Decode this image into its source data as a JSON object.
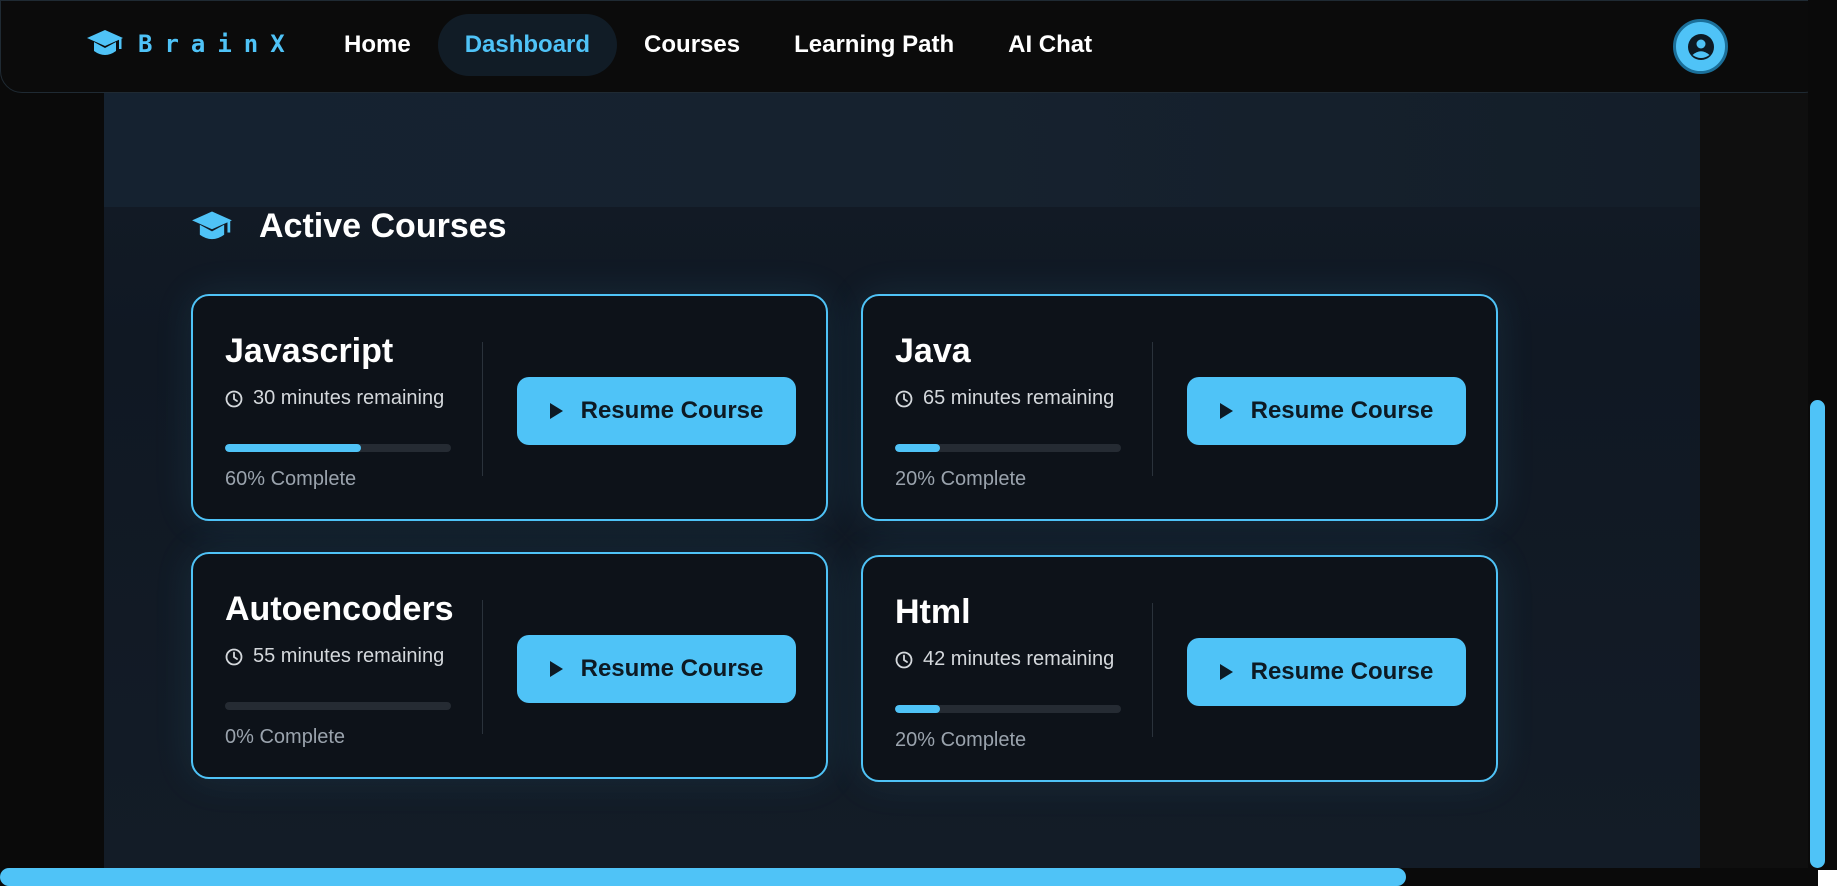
{
  "brand": {
    "name": "BrainX",
    "icon": "graduation-cap-icon",
    "accent": "#4fc3f7"
  },
  "nav": {
    "items": [
      {
        "label": "Home",
        "active": false
      },
      {
        "label": "Dashboard",
        "active": true
      },
      {
        "label": "Courses",
        "active": false
      },
      {
        "label": "Learning Path",
        "active": false
      },
      {
        "label": "AI Chat",
        "active": false
      }
    ],
    "avatar_icon": "user-circle-icon"
  },
  "section": {
    "title": "Active Courses",
    "icon": "graduation-cap-icon"
  },
  "courses": [
    {
      "title": "Javascript",
      "remaining": "30 minutes remaining",
      "progress": 0.6,
      "progress_label": "60% Complete",
      "button": "Resume Course"
    },
    {
      "title": "Java",
      "remaining": "65 minutes remaining",
      "progress": 0.2,
      "progress_label": "20% Complete",
      "button": "Resume Course"
    },
    {
      "title": "Autoencoders",
      "remaining": "55 minutes remaining",
      "progress": 0.0,
      "progress_label": "0% Complete",
      "button": "Resume Course"
    },
    {
      "title": "Html",
      "remaining": "42 minutes remaining",
      "progress": 0.2,
      "progress_label": "20% Complete",
      "button": "Resume Course"
    }
  ],
  "colors": {
    "background": "#0a0a0a",
    "card": "#0d1219",
    "accent": "#4fc3f7"
  }
}
